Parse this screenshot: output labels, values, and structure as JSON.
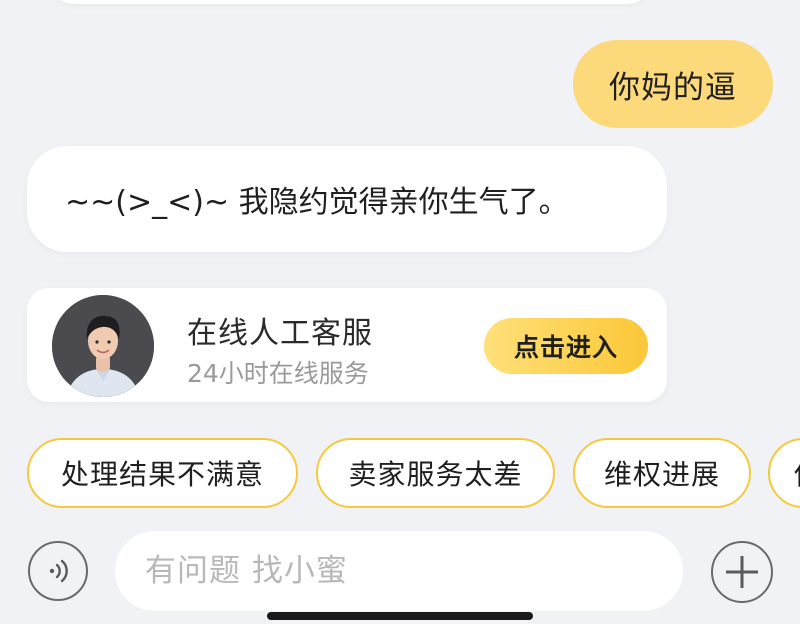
{
  "chat": {
    "user_message": "你妈的逼",
    "bot_message": "~~(>_<)~ 我隐约觉得亲你生气了。"
  },
  "service_card": {
    "title": "在线人工客服",
    "subtitle": "24小时在线服务",
    "button_label": "点击进入"
  },
  "quick_replies": [
    "处理结果不满意",
    "卖家服务太差",
    "维权进展",
    "他"
  ],
  "input_bar": {
    "placeholder": "有问题 找小蜜",
    "voice_icon": "voice-icon",
    "plus_icon": "plus-icon"
  },
  "colors": {
    "user_bubble": "#fcd97a",
    "accent": "#fbc737",
    "chip_border": "#f4c93d",
    "background": "#f1f2f6"
  }
}
